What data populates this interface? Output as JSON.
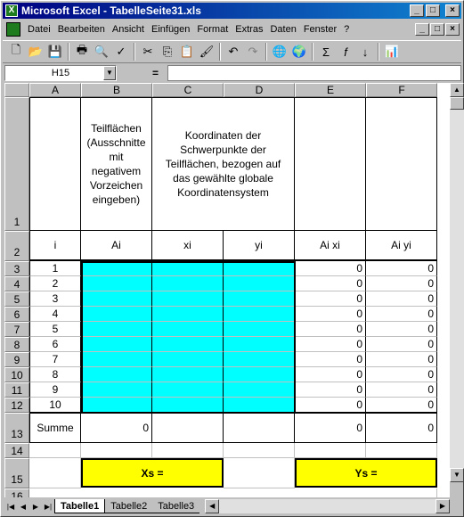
{
  "window": {
    "title": "Microsoft Excel - TabelleSeite31.xls",
    "btn_min": "_",
    "btn_max": "□",
    "btn_close": "×"
  },
  "menu": {
    "items": [
      "Datei",
      "Bearbeiten",
      "Ansicht",
      "Einfügen",
      "Format",
      "Extras",
      "Daten",
      "Fenster",
      "?"
    ]
  },
  "formula": {
    "name": "H15",
    "eq": "="
  },
  "columns": [
    "A",
    "B",
    "C",
    "D",
    "E",
    "F"
  ],
  "rows": [
    "1",
    "2",
    "3",
    "4",
    "5",
    "6",
    "7",
    "8",
    "9",
    "10",
    "11",
    "12",
    "13",
    "14",
    "15",
    "16"
  ],
  "header_text": {
    "b1": "Teilflächen (Ausschnitte mit negativem Vorzeichen eingeben)",
    "cd1": "Koordinaten der Schwerpunkte der Teilflächen, bezogen auf das gewählte globale Koordinatensystem"
  },
  "row2": {
    "a": "i",
    "b": "Ai",
    "c": "xi",
    "d": "yi",
    "e": "Ai xi",
    "f": "Ai yi"
  },
  "data_rows": [
    {
      "i": "1",
      "e": "0",
      "f": "0"
    },
    {
      "i": "2",
      "e": "0",
      "f": "0"
    },
    {
      "i": "3",
      "e": "0",
      "f": "0"
    },
    {
      "i": "4",
      "e": "0",
      "f": "0"
    },
    {
      "i": "5",
      "e": "0",
      "f": "0"
    },
    {
      "i": "6",
      "e": "0",
      "f": "0"
    },
    {
      "i": "7",
      "e": "0",
      "f": "0"
    },
    {
      "i": "8",
      "e": "0",
      "f": "0"
    },
    {
      "i": "9",
      "e": "0",
      "f": "0"
    },
    {
      "i": "10",
      "e": "0",
      "f": "0"
    }
  ],
  "summe": {
    "label": "Summe",
    "b": "0",
    "e": "0",
    "f": "0"
  },
  "results": {
    "xs": "Xs =",
    "ys": "Ys ="
  },
  "sheets": [
    "Tabelle1",
    "Tabelle2",
    "Tabelle3"
  ],
  "colors": {
    "cyan": "#00ffff",
    "yellow": "#ffff00"
  }
}
